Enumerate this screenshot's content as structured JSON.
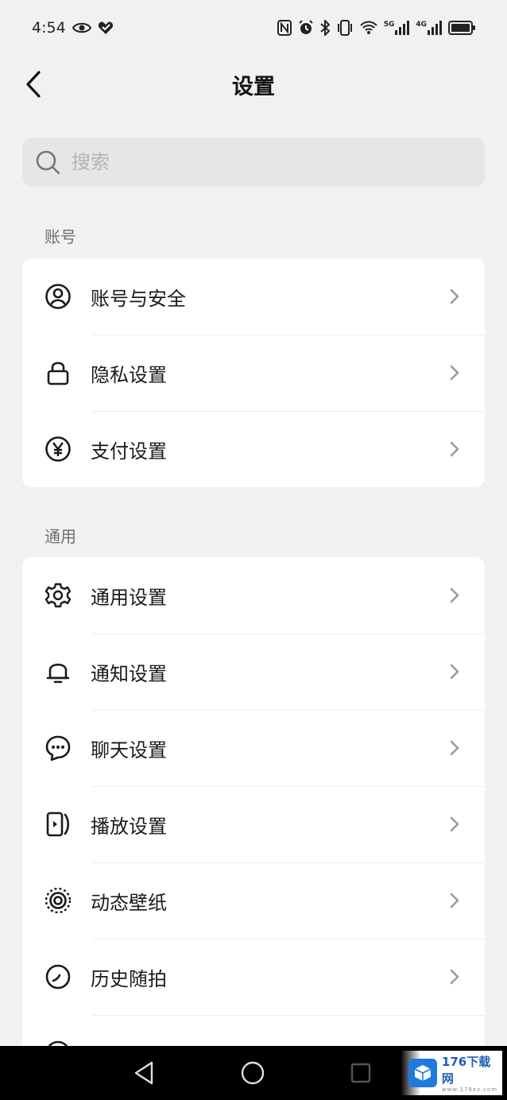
{
  "status_bar": {
    "time": "4:54",
    "icons": [
      "eye-icon",
      "heart-check-icon",
      "nfc-icon",
      "alarm-icon",
      "bluetooth-icon",
      "vibrate-icon",
      "wifi-icon",
      "signal-5g-icon",
      "signal-4g-icon",
      "battery-icon"
    ],
    "net1": "5G",
    "net2": "4G"
  },
  "header": {
    "title": "设置",
    "back_icon": "chevron-left-icon"
  },
  "search": {
    "placeholder": "搜索",
    "value": ""
  },
  "sections": {
    "account": {
      "label": "账号",
      "items": [
        {
          "label": "账号与安全",
          "icon": "user-circle-icon"
        },
        {
          "label": "隐私设置",
          "icon": "lock-icon"
        },
        {
          "label": "支付设置",
          "icon": "yen-circle-icon"
        }
      ]
    },
    "general": {
      "label": "通用",
      "items": [
        {
          "label": "通用设置",
          "icon": "gear-icon"
        },
        {
          "label": "通知设置",
          "icon": "bell-icon"
        },
        {
          "label": "聊天设置",
          "icon": "chat-bubble-icon"
        },
        {
          "label": "播放设置",
          "icon": "play-screen-icon"
        },
        {
          "label": "动态壁纸",
          "icon": "target-ring-icon"
        },
        {
          "label": "历史随拍",
          "icon": "clock-icon"
        }
      ]
    }
  },
  "navbar": {
    "icons": [
      "back-triangle-icon",
      "home-circle-icon",
      "recents-square-icon"
    ]
  },
  "watermark": {
    "title": "176下载网",
    "url": "www.176xz.com"
  },
  "colors": {
    "background": "#f1f1f1",
    "card": "#ffffff",
    "search_bg": "#e6e6e6",
    "section_label": "#6e6e6e"
  }
}
